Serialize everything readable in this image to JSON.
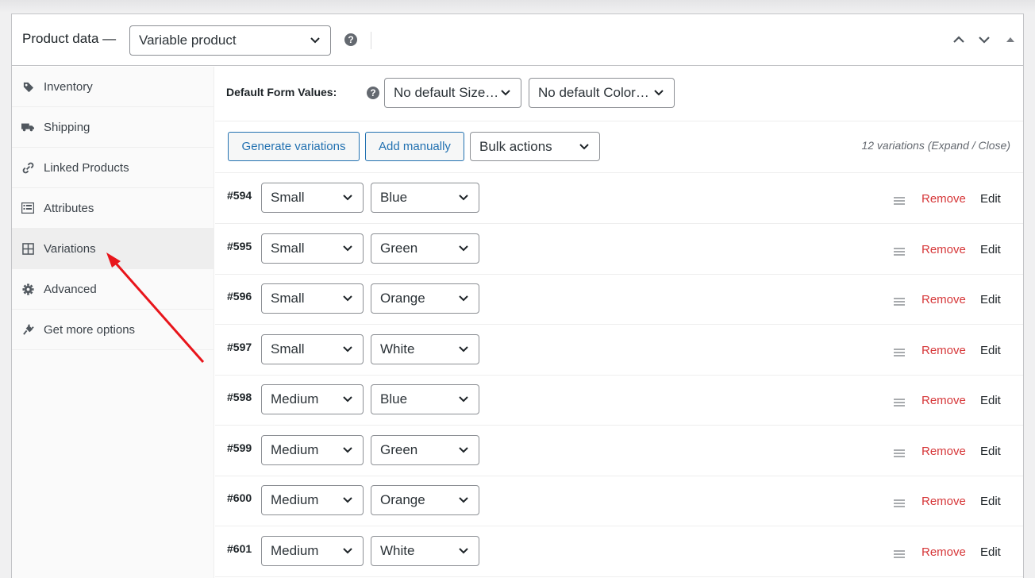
{
  "header": {
    "title": "Product data —",
    "product_type": "Variable product",
    "help": "?"
  },
  "sidebar": {
    "items": [
      {
        "label": "Inventory",
        "icon": "tag-icon"
      },
      {
        "label": "Shipping",
        "icon": "truck-icon"
      },
      {
        "label": "Linked Products",
        "icon": "link-icon"
      },
      {
        "label": "Attributes",
        "icon": "list-view-icon"
      },
      {
        "label": "Variations",
        "icon": "grid-icon",
        "active": true
      },
      {
        "label": "Advanced",
        "icon": "gear-icon"
      },
      {
        "label": "Get more options",
        "icon": "plugin-icon"
      }
    ]
  },
  "defaults": {
    "label": "Default Form Values:",
    "help": "?",
    "size_select": "No default Size…",
    "color_select": "No default Color…"
  },
  "toolbar": {
    "generate": "Generate variations",
    "add_manually": "Add manually",
    "bulk_actions": "Bulk actions",
    "count_text": "12 variations (Expand / Close)"
  },
  "variations": [
    {
      "id": "#594",
      "size": "Small",
      "color": "Blue"
    },
    {
      "id": "#595",
      "size": "Small",
      "color": "Green"
    },
    {
      "id": "#596",
      "size": "Small",
      "color": "Orange"
    },
    {
      "id": "#597",
      "size": "Small",
      "color": "White"
    },
    {
      "id": "#598",
      "size": "Medium",
      "color": "Blue"
    },
    {
      "id": "#599",
      "size": "Medium",
      "color": "Green"
    },
    {
      "id": "#600",
      "size": "Medium",
      "color": "Orange"
    },
    {
      "id": "#601",
      "size": "Medium",
      "color": "White"
    }
  ],
  "row_actions": {
    "remove": "Remove",
    "edit": "Edit"
  },
  "colors": {
    "accent": "#2271b1",
    "remove": "#d63638",
    "annotation_arrow": "#e8151b"
  }
}
